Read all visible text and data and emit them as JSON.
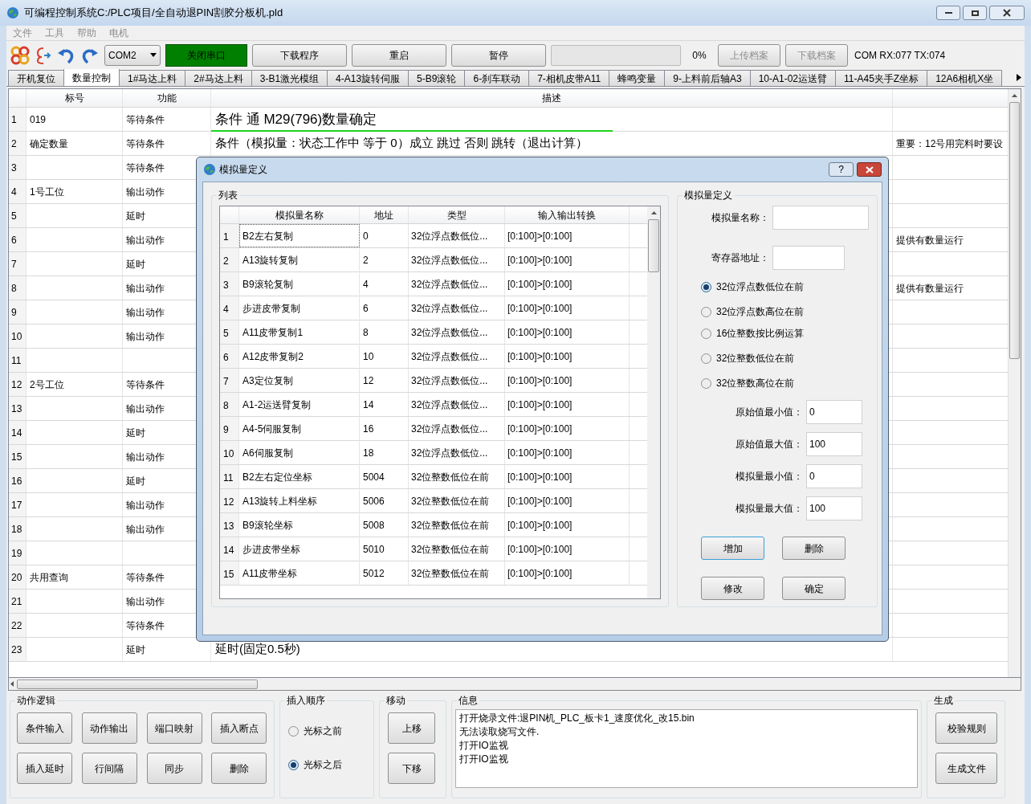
{
  "window": {
    "title": "可编程控制系统C:/PLC项目/全自动退PIN割胶分板机.pld"
  },
  "menu": [
    "文件",
    "工具",
    "帮助",
    "电机"
  ],
  "toolbar": {
    "port": "COM2",
    "port_button": {
      "label": "关闭串口",
      "on": true
    },
    "buttons": [
      "下载程序",
      "重启",
      "暂停"
    ],
    "progress": {
      "level": 0,
      "reading": "0%"
    },
    "file_buttons": [
      {
        "label": "上传档案",
        "disabled": true
      },
      {
        "label": "下载档案",
        "disabled": true
      }
    ],
    "status": "COM RX:077 TX:074"
  },
  "tabs": [
    {
      "label": "开机复位",
      "selected": false
    },
    {
      "label": "数量控制",
      "selected": true
    },
    {
      "label": "1#马达上料",
      "selected": false
    },
    {
      "label": "2#马达上料",
      "selected": false
    },
    {
      "label": "3-B1激光模组",
      "selected": false
    },
    {
      "label": "4-A13旋转伺服",
      "selected": false
    },
    {
      "label": "5-B9滚轮",
      "selected": false
    },
    {
      "label": "6-刹车联动",
      "selected": false
    },
    {
      "label": "7-相机皮带A11",
      "selected": false
    },
    {
      "label": "蜂鸣变量",
      "selected": false
    },
    {
      "label": "9-上料前后轴A3",
      "selected": false
    },
    {
      "label": "10-A1-02运送臂",
      "selected": false
    },
    {
      "label": "11-A45夹手Z坐标",
      "selected": false
    },
    {
      "label": "12A6相机X坐",
      "selected": false
    }
  ],
  "table": {
    "columns": [
      "标号",
      "功能",
      "描述"
    ],
    "rows": [
      {
        "num": "1",
        "label": "019",
        "func": "等待条件",
        "desc": "条件 通 M29(796)数量确定",
        "note": "",
        "highlighted": true
      },
      {
        "num": "2",
        "label": "确定数量",
        "func": "等待条件",
        "desc": "条件（模拟量：状态工作中 等于 0）成立 跳过 否则 跳转（退出计算）",
        "note": "重要：12号用完料时要设",
        "highlighted": false
      },
      {
        "num": "3",
        "label": "",
        "func": "等待条件",
        "desc": "",
        "note": ""
      },
      {
        "num": "4",
        "label": "1号工位",
        "func": "输出动作",
        "desc": "",
        "note": ""
      },
      {
        "num": "5",
        "label": "",
        "func": "延时",
        "desc": "",
        "note": ""
      },
      {
        "num": "6",
        "label": "",
        "func": "输出动作",
        "desc": "",
        "note": "提供有数量运行"
      },
      {
        "num": "7",
        "label": "",
        "func": "延时",
        "desc": "",
        "note": ""
      },
      {
        "num": "8",
        "label": "",
        "func": "输出动作",
        "desc": "",
        "note": "提供有数量运行"
      },
      {
        "num": "9",
        "label": "",
        "func": "输出动作",
        "desc": "",
        "note": ""
      },
      {
        "num": "10",
        "label": "",
        "func": "输出动作",
        "desc": "",
        "note": ""
      },
      {
        "num": "11",
        "label": "",
        "func": "",
        "desc": "",
        "note": ""
      },
      {
        "num": "12",
        "label": "2号工位",
        "func": "等待条件",
        "desc": "",
        "note": ""
      },
      {
        "num": "13",
        "label": "",
        "func": "输出动作",
        "desc": "",
        "note": ""
      },
      {
        "num": "14",
        "label": "",
        "func": "延时",
        "desc": "",
        "note": ""
      },
      {
        "num": "15",
        "label": "",
        "func": "输出动作",
        "desc": "",
        "note": ""
      },
      {
        "num": "16",
        "label": "",
        "func": "延时",
        "desc": "",
        "note": ""
      },
      {
        "num": "17",
        "label": "",
        "func": "输出动作",
        "desc": "",
        "note": ""
      },
      {
        "num": "18",
        "label": "",
        "func": "输出动作",
        "desc": "",
        "note": ""
      },
      {
        "num": "19",
        "label": "",
        "func": "",
        "desc": "",
        "note": ""
      },
      {
        "num": "20",
        "label": "共用查询",
        "func": "等待条件",
        "desc": "",
        "note": ""
      },
      {
        "num": "21",
        "label": "",
        "func": "输出动作",
        "desc": "",
        "note": ""
      },
      {
        "num": "22",
        "label": "",
        "func": "等待条件",
        "desc": "",
        "note": ""
      },
      {
        "num": "23",
        "label": "",
        "func": "延时",
        "desc": "延时(固定0.5秒)",
        "note": "",
        "highlighted": false
      }
    ]
  },
  "bottom": {
    "logic": {
      "title": "动作逻辑",
      "buttons": [
        "条件输入",
        "动作输出",
        "端口映射",
        "插入断点",
        "插入延时",
        "行间隔",
        "同步",
        "删除"
      ]
    },
    "order": {
      "title": "插入顺序",
      "options": [
        {
          "label": "光标之前",
          "selected": false
        },
        {
          "label": "光标之后",
          "selected": true
        }
      ]
    },
    "move": {
      "title": "移动",
      "buttons": [
        "上移",
        "下移"
      ]
    },
    "info": {
      "title": "信息",
      "lines": [
        "打开烧录文件:退PIN机_PLC_板卡1_速度优化_改15.bin",
        "无法读取烧写文件.",
        "打开IO监视",
        "打开IO监视"
      ]
    },
    "generate": {
      "title": "生成",
      "buttons": [
        "校验规则",
        "生成文件"
      ]
    }
  },
  "dialog": {
    "title": "模拟量定义",
    "help": "?",
    "list": {
      "title": "列表",
      "columns": [
        "模拟量名称",
        "地址",
        "类型",
        "输入输出转换"
      ],
      "rows": [
        {
          "num": "1",
          "name": "B2左右复制",
          "addr": "0",
          "type": "32位浮点数低位...",
          "conv": "[0:100]>[0:100]",
          "focused": true
        },
        {
          "num": "2",
          "name": "A13旋转复制",
          "addr": "2",
          "type": "32位浮点数低位...",
          "conv": "[0:100]>[0:100]",
          "focused": false
        },
        {
          "num": "3",
          "name": "B9滚轮复制",
          "addr": "4",
          "type": "32位浮点数低位...",
          "conv": "[0:100]>[0:100]",
          "focused": false
        },
        {
          "num": "4",
          "name": "步进皮带复制",
          "addr": "6",
          "type": "32位浮点数低位...",
          "conv": "[0:100]>[0:100]",
          "focused": false
        },
        {
          "num": "5",
          "name": "A11皮带复制1",
          "addr": "8",
          "type": "32位浮点数低位...",
          "conv": "[0:100]>[0:100]",
          "focused": false
        },
        {
          "num": "6",
          "name": "A12皮带复制2",
          "addr": "10",
          "type": "32位浮点数低位...",
          "conv": "[0:100]>[0:100]",
          "focused": false
        },
        {
          "num": "7",
          "name": "A3定位复制",
          "addr": "12",
          "type": "32位浮点数低位...",
          "conv": "[0:100]>[0:100]",
          "focused": false
        },
        {
          "num": "8",
          "name": "A1-2运送臂复制",
          "addr": "14",
          "type": "32位浮点数低位...",
          "conv": "[0:100]>[0:100]",
          "focused": false
        },
        {
          "num": "9",
          "name": "A4-5伺服复制",
          "addr": "16",
          "type": "32位浮点数低位...",
          "conv": "[0:100]>[0:100]",
          "focused": false
        },
        {
          "num": "10",
          "name": "A6伺服复制",
          "addr": "18",
          "type": "32位浮点数低位...",
          "conv": "[0:100]>[0:100]",
          "focused": false
        },
        {
          "num": "11",
          "name": "B2左右定位坐标",
          "addr": "5004",
          "type": "32位整数低位在前",
          "conv": "[0:100]>[0:100]",
          "focused": false
        },
        {
          "num": "12",
          "name": "A13旋转上料坐标",
          "addr": "5006",
          "type": "32位整数低位在前",
          "conv": "[0:100]>[0:100]",
          "focused": false
        },
        {
          "num": "13",
          "name": "B9滚轮坐标",
          "addr": "5008",
          "type": "32位整数低位在前",
          "conv": "[0:100]>[0:100]",
          "focused": false
        },
        {
          "num": "14",
          "name": "步进皮带坐标",
          "addr": "5010",
          "type": "32位整数低位在前",
          "conv": "[0:100]>[0:100]",
          "focused": false
        },
        {
          "num": "15",
          "name": "A11皮带坐标",
          "addr": "5012",
          "type": "32位整数低位在前",
          "conv": "[0:100]>[0:100]",
          "focused": false
        }
      ]
    },
    "form": {
      "title": "模拟量定义",
      "name_label": "模拟量名称：",
      "addr_label": "寄存器地址：",
      "types": [
        {
          "label": "32位浮点数低位在前",
          "selected": true
        },
        {
          "label": "32位浮点数高位在前",
          "selected": false
        },
        {
          "label": "16位整数按比例运算",
          "selected": false
        },
        {
          "label": "32位整数低位在前",
          "selected": false
        },
        {
          "label": "32位整数高位在前",
          "selected": false
        }
      ],
      "values": [
        {
          "label": "原始值最小值：",
          "value": "0"
        },
        {
          "label": "原始值最大值：",
          "value": "100"
        },
        {
          "label": "模拟量最小值：",
          "value": "0"
        },
        {
          "label": "模拟量最大值：",
          "value": "100"
        }
      ],
      "buttons": [
        {
          "label": "增加",
          "default": true
        },
        {
          "label": "删除",
          "default": false
        },
        {
          "label": "修改",
          "default": false
        },
        {
          "label": "确定",
          "default": false
        }
      ]
    }
  }
}
